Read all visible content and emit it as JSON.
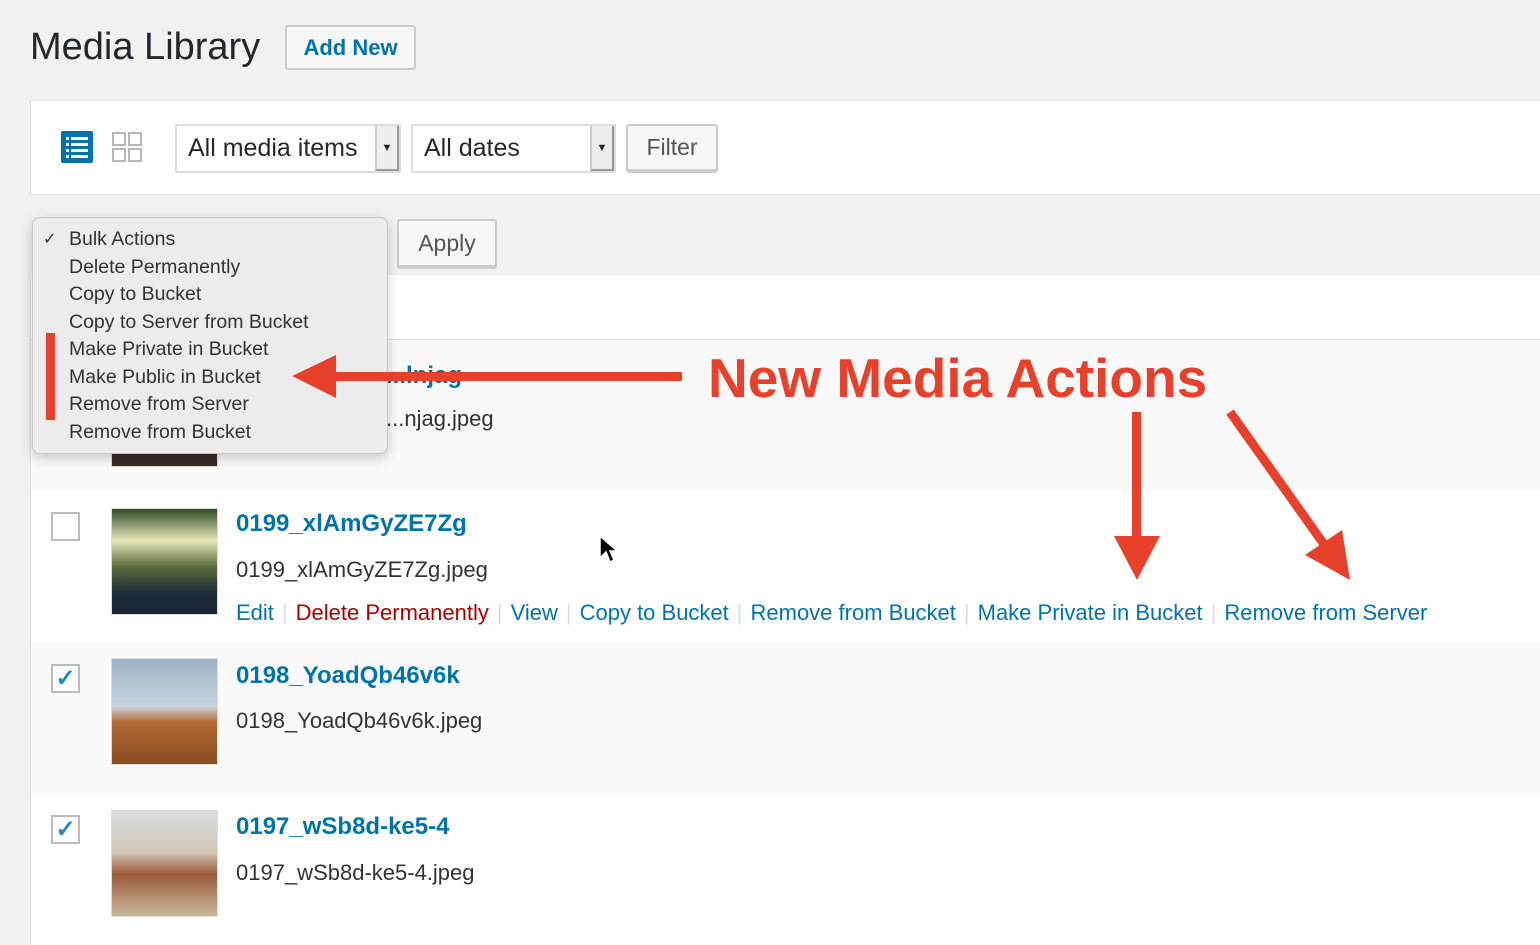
{
  "header": {
    "title": "Media Library",
    "add_new": "Add New"
  },
  "filters": {
    "media_type": "All media items",
    "dates": "All dates",
    "filter_button": "Filter",
    "view_modes": [
      "list-icon",
      "grid-icon"
    ]
  },
  "bulk": {
    "apply": "Apply",
    "options": [
      "Bulk Actions",
      "Delete Permanently",
      "Copy to Bucket",
      "Copy to Server from Bucket",
      "Make Private in Bucket",
      "Make Public in Bucket",
      "Remove from Server",
      "Remove from Bucket"
    ],
    "selected": "Bulk Actions"
  },
  "rows": [
    {
      "title": "...lnjag",
      "filename": "...njag.jpeg",
      "checked": false
    },
    {
      "title": "0199_xlAmGyZE7Zg",
      "filename": "0199_xlAmGyZE7Zg.jpeg",
      "checked": false,
      "actions": [
        "Edit",
        "Delete Permanently",
        "View",
        "Copy to Bucket",
        "Remove from Bucket",
        "Make Private in Bucket",
        "Remove from Server"
      ]
    },
    {
      "title": "0198_YoadQb46v6k",
      "filename": "0198_YoadQb46v6k.jpeg",
      "checked": true
    },
    {
      "title": "0197_wSb8d-ke5-4",
      "filename": "0197_wSb8d-ke5-4.jpeg",
      "checked": true
    }
  ],
  "annotation": {
    "text": "New Media Actions",
    "color": "#e8412b"
  },
  "colors": {
    "link": "#0073aa",
    "delete": "#aa0000",
    "accent": "#e8412b"
  }
}
